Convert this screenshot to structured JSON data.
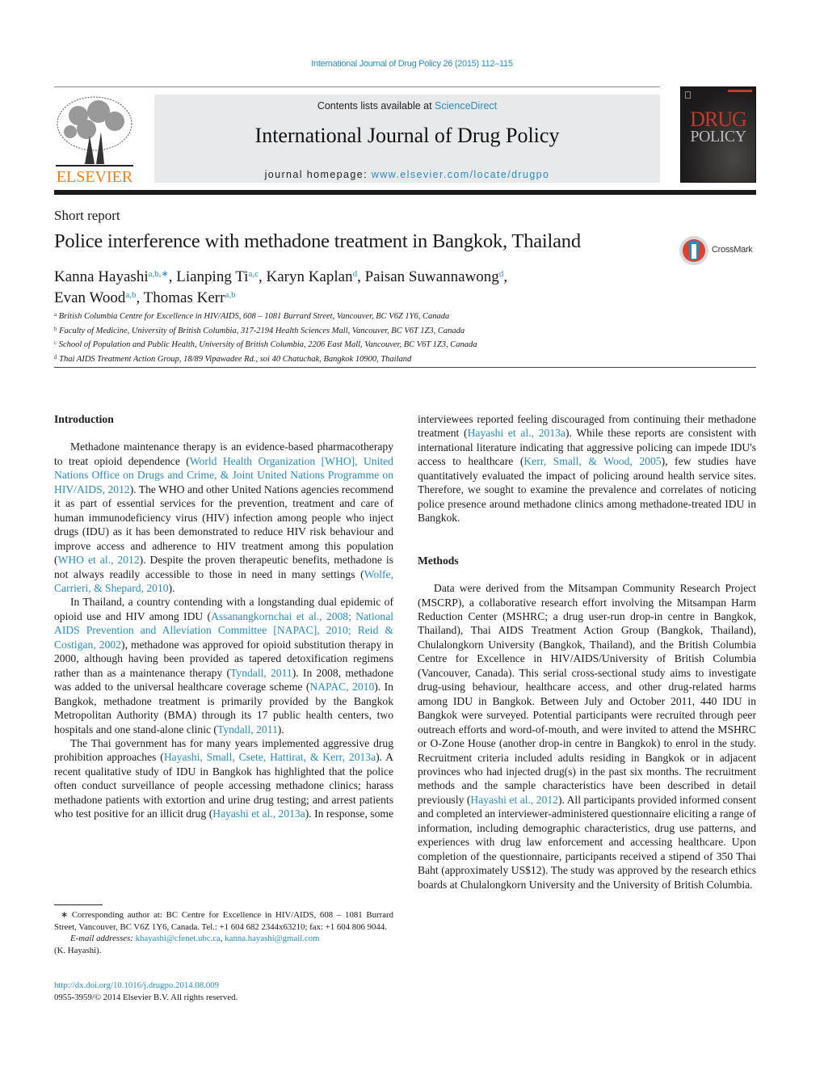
{
  "header": {
    "citation": "International Journal of Drug Policy 26 (2015) 112–115",
    "contents_prefix": "Contents lists available at ",
    "contents_link": "ScienceDirect",
    "journal_title": "International Journal of Drug Policy",
    "homepage_prefix": "journal homepage: ",
    "homepage_link": "www.elsevier.com/locate/drugpo",
    "publisher_logo": "ELSEVIER",
    "cover_line1": "DRUG",
    "cover_line2": "POLICY",
    "crossmark": "CrossMark"
  },
  "colors": {
    "link": "#2a8bbf",
    "elsevier_orange": "#f07d1a",
    "cover_red": "#c5392a",
    "banner_bg": "#e8e9eb"
  },
  "article": {
    "type": "Short report",
    "title": "Police interference with methadone treatment in Bangkok, Thailand",
    "authors": [
      {
        "name": "Kanna Hayashi",
        "aff": "a,b,∗",
        "sep": ", "
      },
      {
        "name": "Lianping Ti",
        "aff": "a,c",
        "sep": ", "
      },
      {
        "name": "Karyn Kaplan",
        "aff": "d",
        "sep": ", "
      },
      {
        "name": "Paisan Suwannawong",
        "aff": "d",
        "sep": ","
      },
      {
        "name": "Evan Wood",
        "aff": "a,b",
        "sep": ", "
      },
      {
        "name": "Thomas Kerr",
        "aff": "a,b",
        "sep": ""
      }
    ],
    "affiliations": [
      {
        "key": "a",
        "text": "British Columbia Centre for Excellence in HIV/AIDS, 608 – 1081 Burrard Street, Vancouver, BC V6Z 1Y6, Canada"
      },
      {
        "key": "b",
        "text": "Faculty of Medicine, University of British Columbia, 317-2194 Health Sciences Mall, Vancouver, BC V6T 1Z3, Canada"
      },
      {
        "key": "c",
        "text": "School of Population and Public Health, University of British Columbia, 2206 East Mall, Vancouver, BC V6T 1Z3, Canada"
      },
      {
        "key": "d",
        "text": "Thai AIDS Treatment Action Group, 18/89 Vipawadee Rd., soi 40 Chatuchak, Bangkok 10900, Thailand"
      }
    ]
  },
  "body": {
    "intro_heading": "Introduction",
    "methods_heading": "Methods",
    "intro_p1": [
      {
        "t": "Methadone maintenance therapy is an evidence-based pharmacotherapy to treat opioid dependence ("
      },
      {
        "t": "World Health Organization [WHO], United Nations Office on Drugs and Crime, & Joint United Nations Programme on HIV/AIDS, 2012",
        "link": true
      },
      {
        "t": "). The WHO and other United Nations agencies recommend it as part of essential services for the prevention, treatment and care of human immunodeficiency virus (HIV) infection among people who inject drugs (IDU) as it has been demonstrated to reduce HIV risk behaviour and improve access and adherence to HIV treatment among this population ("
      },
      {
        "t": "WHO et al., 2012",
        "link": true
      },
      {
        "t": "). Despite the proven therapeutic benefits, methadone is not always readily accessible to those in need in many settings ("
      },
      {
        "t": "Wolfe, Carrieri, & Shepard, 2010",
        "link": true
      },
      {
        "t": ")."
      }
    ],
    "intro_p2": [
      {
        "t": "In Thailand, a country contending with a longstanding dual epidemic of opioid use and HIV among IDU ("
      },
      {
        "t": "Assanangkornchai et al., 2008; National AIDS Prevention and Alleviation Committee [NAPAC], 2010; Reid & Costigan, 2002",
        "link": true
      },
      {
        "t": "), methadone was approved for opioid substitution therapy in 2000, although having been provided as tapered detoxification regimens rather than as a maintenance therapy ("
      },
      {
        "t": "Tyndall, 2011",
        "link": true
      },
      {
        "t": "). In 2008, methadone was added to the universal healthcare coverage scheme ("
      },
      {
        "t": "NAPAC, 2010",
        "link": true
      },
      {
        "t": "). In Bangkok, methadone treatment is primarily provided by the Bangkok Metropolitan Authority (BMA) through its 17 public health centers, two hospitals and one stand-alone clinic ("
      },
      {
        "t": "Tyndall, 2011",
        "link": true
      },
      {
        "t": ")."
      }
    ],
    "intro_p3a": [
      {
        "t": "The Thai government has for many years implemented aggressive drug prohibition approaches ("
      },
      {
        "t": "Hayashi, Small, Csete, Hattirat, & Kerr, 2013a",
        "link": true
      },
      {
        "t": "). A recent qualitative study of IDU in Bangkok has highlighted that the police often conduct surveillance of people accessing methadone clinics; harass methadone patients with extortion and urine drug testing; and arrest patients who test positive for an illicit drug ("
      },
      {
        "t": "Hayashi et al., 2013a",
        "link": true
      },
      {
        "t": "). In response, some"
      }
    ],
    "intro_p3b": [
      {
        "t": "interviewees reported feeling discouraged from continuing their methadone treatment ("
      },
      {
        "t": "Hayashi et al., 2013a",
        "link": true
      },
      {
        "t": "). While these reports are consistent with international literature indicating that aggressive policing can impede IDU's access to healthcare ("
      },
      {
        "t": "Kerr, Small, & Wood, 2005",
        "link": true
      },
      {
        "t": "), few studies have quantitatively evaluated the impact of policing around health service sites. Therefore, we sought to examine the prevalence and correlates of noticing police presence around methadone clinics among methadone-treated IDU in Bangkok."
      }
    ],
    "methods_p1": [
      {
        "t": "Data were derived from the Mitsampan Community Research Project (MSCRP), a collaborative research effort involving the Mitsampan Harm Reduction Center (MSHRC; a drug user-run drop-in centre in Bangkok, Thailand), Thai AIDS Treatment Action Group (Bangkok, Thailand), Chulalongkorn University (Bangkok, Thailand), and the British Columbia Centre for Excellence in HIV/AIDS/University of British Columbia (Vancouver, Canada). This serial cross-sectional study aims to investigate drug-using behaviour, healthcare access, and other drug-related harms among IDU in Bangkok. Between July and October 2011, 440 IDU in Bangkok were surveyed. Potential participants were recruited through peer outreach efforts and word-of-mouth, and were invited to attend the MSHRC or O-Zone House (another drop-in centre in Bangkok) to enrol in the study. Recruitment criteria included adults residing in Bangkok or in adjacent provinces who had injected drug(s) in the past six months. The recruitment methods and the sample characteristics have been described in detail previously ("
      },
      {
        "t": "Hayashi et al., 2012",
        "link": true
      },
      {
        "t": "). All participants provided informed consent and completed an interviewer-administered questionnaire eliciting a range of information, including demographic characteristics, drug use patterns, and experiences with drug law enforcement and accessing healthcare. Upon completion of the questionnaire, participants received a stipend of 350 Thai Baht (approximately US$12). The study was approved by the research ethics boards at Chulalongkorn University and the University of British Columbia."
      }
    ]
  },
  "footnote": {
    "corresponding": "∗ Corresponding author at: BC Centre for Excellence in HIV/AIDS, 608 – 1081 Burrard Street, Vancouver, BC V6Z 1Y6, Canada. Tel.: +1 604 682 2344x63210; fax: +1 604 806 9044.",
    "email_label": "E-mail addresses: ",
    "email1": "khayashi@cfenet.ubc.ca",
    "email_sep": ", ",
    "email2": "kanna.hayashi@gmail.com",
    "email_owner": "(K. Hayashi).",
    "doi": "http://dx.doi.org/10.1016/j.drugpo.2014.08.009",
    "copyright": "0955-3959/© 2014 Elsevier B.V. All rights reserved."
  }
}
